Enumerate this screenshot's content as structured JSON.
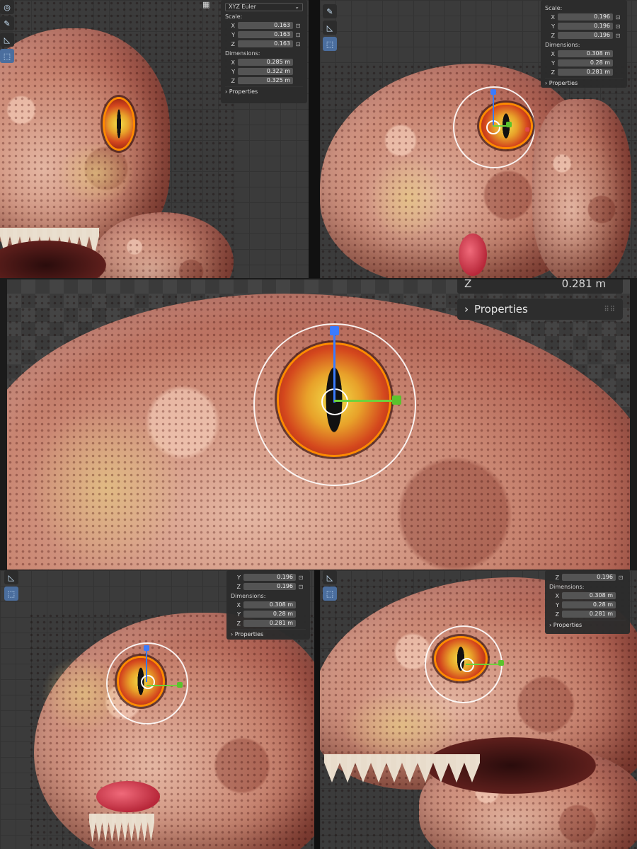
{
  "panel1": {
    "rotation_mode": "XYZ Euler",
    "scale_label": "Scale:",
    "scale": [
      {
        "axis": "X",
        "value": "0.163"
      },
      {
        "axis": "Y",
        "value": "0.163"
      },
      {
        "axis": "Z",
        "value": "0.163"
      }
    ],
    "dimensions_label": "Dimensions:",
    "dimensions": [
      {
        "axis": "X",
        "value": "0.285 m"
      },
      {
        "axis": "Y",
        "value": "0.322 m"
      },
      {
        "axis": "Z",
        "value": "0.325 m"
      }
    ],
    "properties_label": "Properties"
  },
  "panel2": {
    "scale_label": "Scale:",
    "scale": [
      {
        "axis": "X",
        "value": "0.196"
      },
      {
        "axis": "Y",
        "value": "0.196"
      },
      {
        "axis": "Z",
        "value": "0.196"
      }
    ],
    "dimensions_label": "Dimensions:",
    "dimensions": [
      {
        "axis": "X",
        "value": "0.308 m"
      },
      {
        "axis": "Y",
        "value": "0.28 m"
      },
      {
        "axis": "Z",
        "value": "0.281 m"
      }
    ],
    "properties_label": "Properties"
  },
  "panel3": {
    "z_axis": "Z",
    "z_value": "0.281 m",
    "properties_label": "Properties"
  },
  "panel4": {
    "scale": [
      {
        "axis": "Y",
        "value": "0.196"
      },
      {
        "axis": "Z",
        "value": "0.196"
      }
    ],
    "dimensions_label": "Dimensions:",
    "dimensions": [
      {
        "axis": "X",
        "value": "0.308 m"
      },
      {
        "axis": "Y",
        "value": "0.28 m"
      },
      {
        "axis": "Z",
        "value": "0.281 m"
      }
    ],
    "properties_label": "Properties"
  },
  "panel5": {
    "scale": [
      {
        "axis": "Z",
        "value": "0.196"
      }
    ],
    "dimensions_label": "Dimensions:",
    "dimensions": [
      {
        "axis": "X",
        "value": "0.308 m"
      },
      {
        "axis": "Y",
        "value": "0.28 m"
      },
      {
        "axis": "Z",
        "value": "0.281 m"
      }
    ],
    "properties_label": "Properties"
  },
  "colors": {
    "gizmo_z": "#3a7bff",
    "gizmo_x": "#6ed23c",
    "gizmo_y": "#e04848",
    "selection_outline": "#ff8a00"
  }
}
